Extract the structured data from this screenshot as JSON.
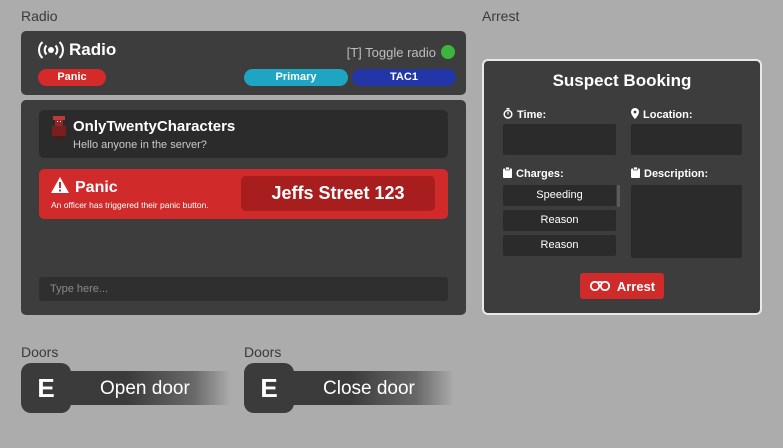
{
  "sections": {
    "radio_label": "Radio",
    "arrest_label": "Arrest",
    "doors_label_1": "Doors",
    "doors_label_2": "Doors"
  },
  "radio": {
    "title": "Radio",
    "toggle_hint": "[T] Toggle radio",
    "status_color": "#3bb53b",
    "channels": {
      "panic": "Panic",
      "primary": "Primary",
      "tac1": "TAC1"
    }
  },
  "messages": [
    {
      "name": "OnlyTwentyCharacters",
      "text": "Hello anyone in the server?"
    }
  ],
  "panic": {
    "title": "Panic",
    "subtitle": "An officer has triggered their panic button.",
    "location": "Jeffs Street 123"
  },
  "chat": {
    "placeholder": "Type here..."
  },
  "booking": {
    "title": "Suspect Booking",
    "time_label": "Time:",
    "location_label": "Location:",
    "charges_label": "Charges:",
    "description_label": "Description:",
    "charges": [
      "Speeding",
      "Reason",
      "Reason"
    ],
    "arrest_button": "Arrest"
  },
  "doors": [
    {
      "key": "E",
      "label": "Open door"
    },
    {
      "key": "E",
      "label": "Close door"
    }
  ],
  "colors": {
    "panel": "#3d3d3d",
    "panic_red": "#d12a2a",
    "primary_cyan": "#1fa5c4",
    "tac1_blue": "#2236a8"
  }
}
